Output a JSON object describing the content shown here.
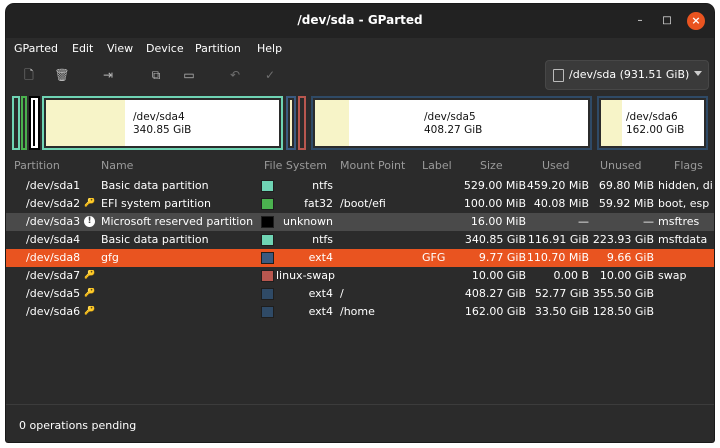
{
  "window": {
    "title": "/dev/sda - GParted",
    "min_glyph": "–",
    "max_glyph": "□",
    "close_glyph": "×"
  },
  "menu": [
    "GParted",
    "Edit",
    "View",
    "Device",
    "Partition",
    "Help"
  ],
  "toolbar": {
    "new_icon": "🗋",
    "delete_icon": "🗑",
    "resize_icon": "⇥",
    "copy_icon": "⧉",
    "paste_icon": "▭",
    "undo_icon": "↶",
    "apply_icon": "✓"
  },
  "device_selector": {
    "label": "/dev/sda (931.51 GiB)"
  },
  "disk_map": [
    {
      "name": "/dev/sda4",
      "size": "340.85 GiB"
    },
    {
      "name": "/dev/sda5",
      "size": "408.27 GiB"
    },
    {
      "name": "/dev/sda6",
      "size": "162.00 GiB"
    }
  ],
  "columns": [
    "Partition",
    "Name",
    "File System",
    "Mount Point",
    "Label",
    "Size",
    "Used",
    "Unused",
    "Flags"
  ],
  "rows": [
    {
      "partition": "/dev/sda1",
      "indicator": "",
      "name": "Basic data partition",
      "fs_color": "#6fd4b4",
      "filesystem": "ntfs",
      "mount": "",
      "label": "",
      "size": "529.00 MiB",
      "used": "459.20 MiB",
      "unused": "69.80 MiB",
      "flags": "hidden, di"
    },
    {
      "partition": "/dev/sda2",
      "indicator": "🔑",
      "name": "EFI system partition",
      "fs_color": "#4bb24f",
      "filesystem": "fat32",
      "mount": "/boot/efi",
      "label": "",
      "size": "100.00 MiB",
      "used": "40.08 MiB",
      "unused": "59.92 MiB",
      "flags": "boot, esp"
    },
    {
      "partition": "/dev/sda3",
      "indicator": "!",
      "name": "Microsoft reserved partition",
      "fs_color": "#000000",
      "filesystem": "unknown",
      "mount": "",
      "label": "",
      "size": "16.00 MiB",
      "used": "—",
      "unused": "—",
      "flags": "msftres"
    },
    {
      "partition": "/dev/sda4",
      "indicator": "",
      "name": "Basic data partition",
      "fs_color": "#6fd4b4",
      "filesystem": "ntfs",
      "mount": "",
      "label": "",
      "size": "340.85 GiB",
      "used": "116.91 GiB",
      "unused": "223.93 GiB",
      "flags": "msftdata"
    },
    {
      "partition": "/dev/sda8",
      "indicator": "",
      "name": "gfg",
      "fs_color": "#3a5a80",
      "filesystem": "ext4",
      "mount": "",
      "label": "GFG",
      "size": "9.77 GiB",
      "used": "110.70 MiB",
      "unused": "9.66 GiB",
      "flags": ""
    },
    {
      "partition": "/dev/sda7",
      "indicator": "🔑",
      "name": "",
      "fs_color": "#b8574f",
      "filesystem": "linux-swap",
      "mount": "",
      "label": "",
      "size": "10.00 GiB",
      "used": "0.00 B",
      "unused": "10.00 GiB",
      "flags": "swap"
    },
    {
      "partition": "/dev/sda5",
      "indicator": "🔑",
      "name": "",
      "fs_color": "#2f4a66",
      "filesystem": "ext4",
      "mount": "/",
      "label": "",
      "size": "408.27 GiB",
      "used": "52.77 GiB",
      "unused": "355.50 GiB",
      "flags": ""
    },
    {
      "partition": "/dev/sda6",
      "indicator": "🔑",
      "name": "",
      "fs_color": "#2f4a66",
      "filesystem": "ext4",
      "mount": "/home",
      "label": "",
      "size": "162.00 GiB",
      "used": "33.50 GiB",
      "unused": "128.50 GiB",
      "flags": ""
    }
  ],
  "status": {
    "text": "0 operations pending"
  },
  "colors": {
    "accent": "#e95420",
    "background": "#2b2b2b",
    "titlebar": "#222222"
  }
}
